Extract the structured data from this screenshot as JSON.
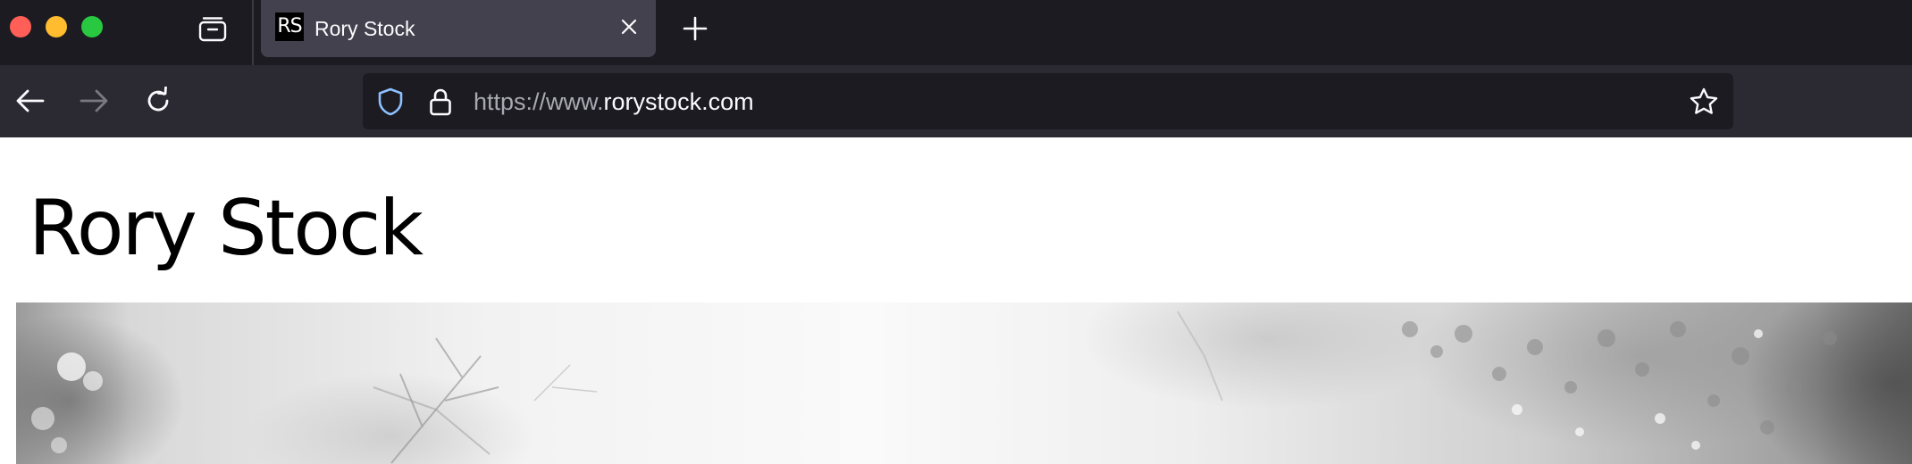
{
  "tab": {
    "favicon_text": "RS",
    "title": "Rory Stock"
  },
  "address_bar": {
    "url_prefix": "https://www.",
    "url_domain": "rorystock.com"
  },
  "page": {
    "site_title": "Rory Stock"
  },
  "icons": {
    "tabs_button": "tab-manager-icon",
    "close": "close-icon",
    "new_tab": "plus-icon",
    "back": "arrow-left-icon",
    "forward": "arrow-right-icon",
    "reload": "reload-icon",
    "tracking": "shield-icon",
    "security": "lock-icon",
    "bookmark": "star-icon"
  },
  "colors": {
    "tabstrip_bg": "#1c1b22",
    "toolbar_bg": "#2b2a33",
    "active_tab_bg": "#42414d",
    "shield_accent": "#8cc2ff",
    "traffic_red": "#ff5f57",
    "traffic_yellow": "#febc2e",
    "traffic_green": "#28c840"
  }
}
